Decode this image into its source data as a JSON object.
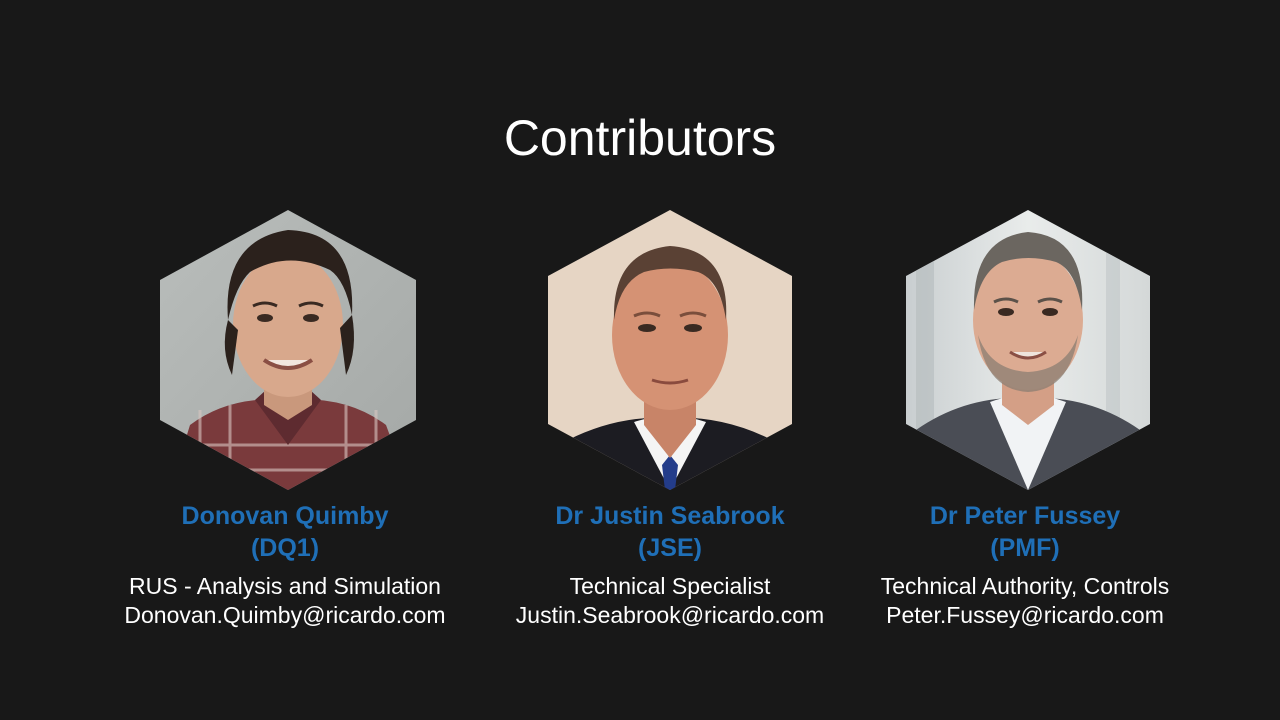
{
  "slide": {
    "title": "Contributors"
  },
  "contributors": [
    {
      "name": "Donovan Quimby",
      "code": "(DQ1)",
      "role": "RUS - Analysis and Simulation",
      "email": "Donovan.Quimby@ricardo.com"
    },
    {
      "name": "Dr Justin Seabrook",
      "code": "(JSE)",
      "role": "Technical Specialist",
      "email": "Justin.Seabrook@ricardo.com"
    },
    {
      "name": "Dr Peter Fussey",
      "code": "(PMF)",
      "role": "Technical Authority, Controls",
      "email": "Peter.Fussey@ricardo.com"
    }
  ],
  "colors": {
    "background": "#181818",
    "accent": "#1f6fb7",
    "text": "#ffffff"
  }
}
